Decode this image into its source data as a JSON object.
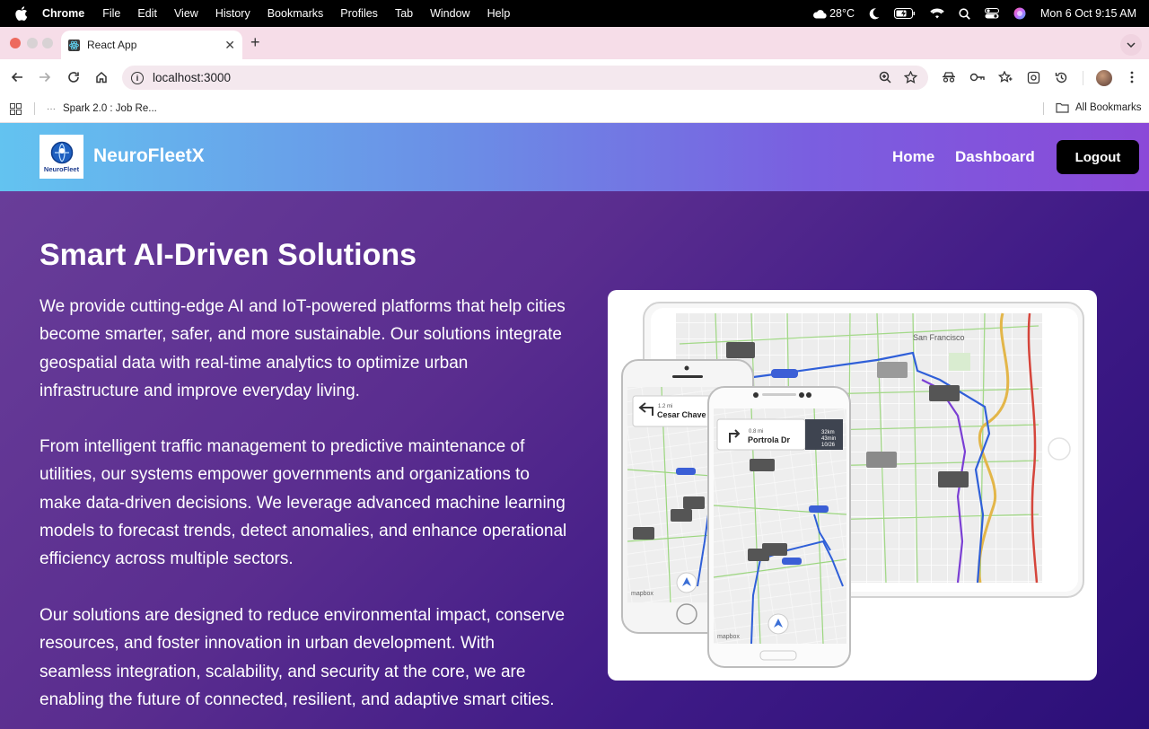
{
  "menubar": {
    "app_name": "Chrome",
    "menus": [
      "File",
      "Edit",
      "View",
      "History",
      "Bookmarks",
      "Profiles",
      "Tab",
      "Window",
      "Help"
    ],
    "temperature": "28°C",
    "datetime": "Mon 6 Oct  9:15 AM"
  },
  "browser": {
    "tab_title": "React App",
    "url": "localhost:3000",
    "bookmark_item": "Spark 2.0 : Job Re...",
    "all_bookmarks": "All Bookmarks"
  },
  "site": {
    "logo_caption": "NeuroFleet",
    "brand": "NeuroFleetX",
    "nav": {
      "home": "Home",
      "dashboard": "Dashboard",
      "logout": "Logout"
    },
    "title": "Smart AI-Driven Solutions",
    "paragraphs": [
      "We provide cutting-edge AI and IoT-powered platforms that help cities become smarter, safer, and more sustainable. Our solutions integrate geospatial data with real-time analytics to optimize urban infrastructure and improve everyday living.",
      "From intelligent traffic management to predictive maintenance of utilities, our systems empower governments and organizations to make data-driven decisions. We leverage advanced machine learning models to forecast trends, detect anomalies, and enhance operational efficiency across multiple sectors.",
      "Our solutions are designed to reduce environmental impact, conserve resources, and foster innovation in urban development. With seamless integration, scalability, and security at the core, we are enabling the future of connected, resilient, and adaptive smart cities."
    ]
  },
  "map_image": {
    "tablet_area": "San Francisco",
    "phone_left": {
      "distance": "1.2 mi",
      "street": "Cesar Chave"
    },
    "phone_right": {
      "distance": "0.8 mi",
      "street": "Portrola Dr",
      "eta_1": "32km",
      "eta_2": "43min",
      "eta_3": "10/26"
    },
    "brand_mark": "mapbox"
  }
}
